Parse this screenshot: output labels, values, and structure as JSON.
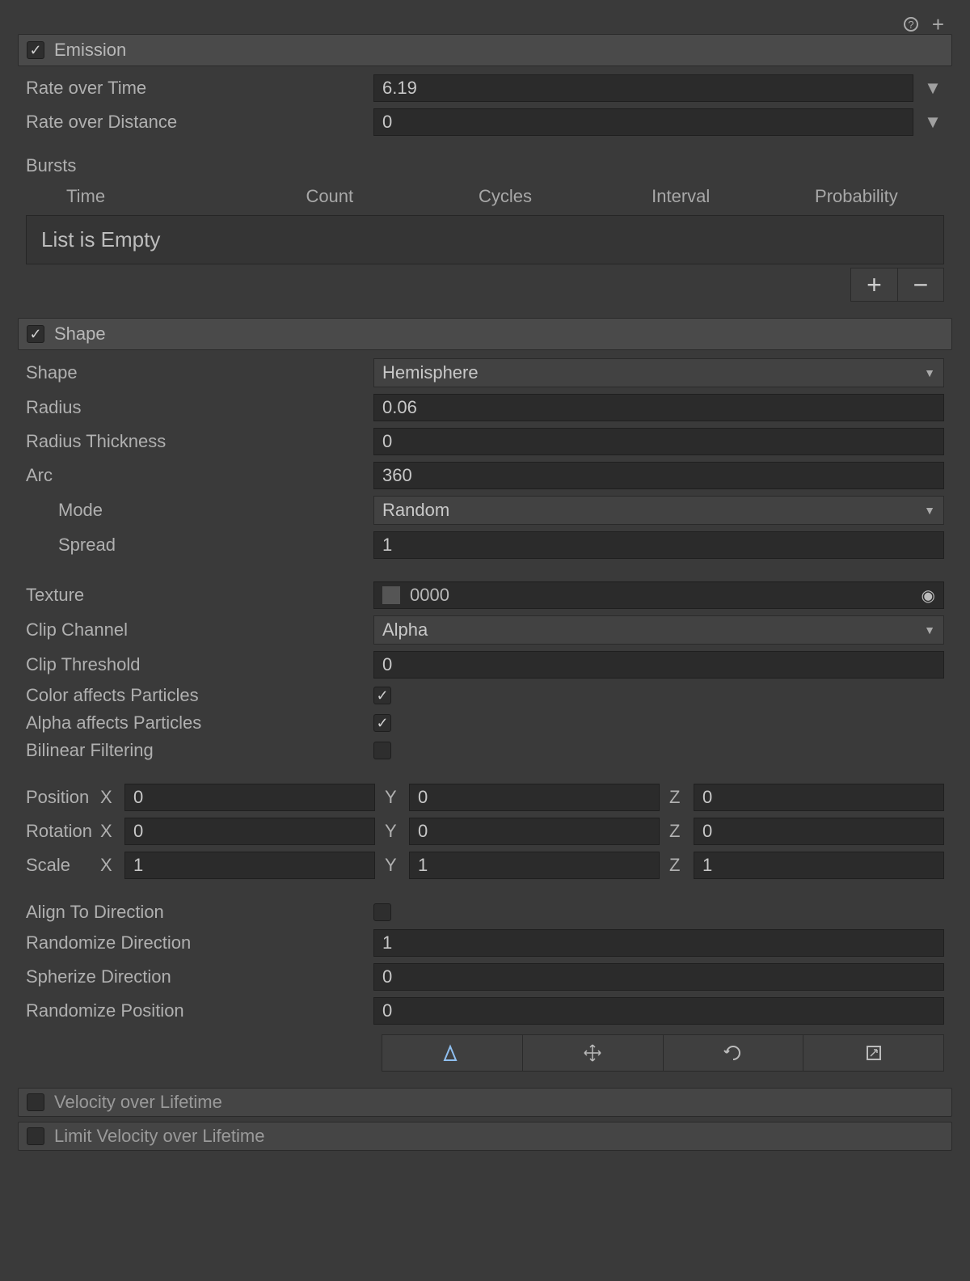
{
  "modules": {
    "emission": {
      "title": "Emission",
      "enabled": true
    },
    "shape": {
      "title": "Shape",
      "enabled": true
    },
    "velocity": {
      "title": "Velocity over Lifetime",
      "enabled": false
    },
    "limitVelocity": {
      "title": "Limit Velocity over Lifetime",
      "enabled": false
    }
  },
  "emission": {
    "rateOverTimeLabel": "Rate over Time",
    "rateOverTime": "6.19",
    "rateOverDistanceLabel": "Rate over Distance",
    "rateOverDistance": "0",
    "burstsLabel": "Bursts",
    "burstsHeaders": {
      "time": "Time",
      "count": "Count",
      "cycles": "Cycles",
      "interval": "Interval",
      "probability": "Probability"
    },
    "emptyText": "List is Empty",
    "addLabel": "+",
    "removeLabel": "−"
  },
  "shape": {
    "shapeLabel": "Shape",
    "shapeValue": "Hemisphere",
    "radiusLabel": "Radius",
    "radius": "0.06",
    "radiusThicknessLabel": "Radius Thickness",
    "radiusThickness": "0",
    "arcLabel": "Arc",
    "arc": "360",
    "modeLabel": "Mode",
    "modeValue": "Random",
    "spreadLabel": "Spread",
    "spread": "1",
    "textureLabel": "Texture",
    "textureValue": "0000",
    "clipChannelLabel": "Clip Channel",
    "clipChannelValue": "Alpha",
    "clipThresholdLabel": "Clip Threshold",
    "clipThreshold": "0",
    "colorAffectsLabel": "Color affects Particles",
    "alphaAffectsLabel": "Alpha affects Particles",
    "bilinearLabel": "Bilinear Filtering",
    "positionLabel": "Position",
    "position": {
      "x": "0",
      "y": "0",
      "z": "0"
    },
    "rotationLabel": "Rotation",
    "rotation": {
      "x": "0",
      "y": "0",
      "z": "0"
    },
    "scaleLabel": "Scale",
    "scale": {
      "x": "1",
      "y": "1",
      "z": "1"
    },
    "alignLabel": "Align To Direction",
    "randomizeDirLabel": "Randomize Direction",
    "randomizeDir": "1",
    "spherizeDirLabel": "Spherize Direction",
    "spherizeDir": "0",
    "randomizePosLabel": "Randomize Position",
    "randomizePos": "0"
  },
  "axis": {
    "x": "X",
    "y": "Y",
    "z": "Z"
  }
}
